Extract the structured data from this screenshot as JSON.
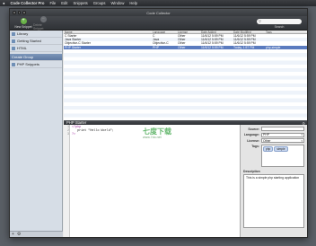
{
  "menubar": {
    "apple": "",
    "items": [
      "Code Collector Pro",
      "File",
      "Edit",
      "Snippets",
      "Groups",
      "Window",
      "Help"
    ]
  },
  "window": {
    "title": "Code Collector"
  },
  "toolbar": {
    "new_label": "New Snippet",
    "delete_label": "Delete Snippet",
    "search_placeholder": "",
    "search_label": "Search"
  },
  "sidebar": {
    "items": [
      {
        "label": "Library"
      },
      {
        "label": "Getting Started"
      },
      {
        "label": "HTML"
      },
      {
        "label": "Create Group"
      },
      {
        "label": "PHP Snippets"
      }
    ],
    "bottom": {
      "add": "+",
      "gear": "⚙"
    }
  },
  "table": {
    "headers": [
      "Name",
      "Language",
      "License",
      "Date Added",
      "Date Modified",
      "Tags"
    ],
    "rows": [
      {
        "name": "C Starter",
        "language": "C",
        "license": "Other",
        "added": "11/6/12 5:59 PM",
        "modified": "11/6/12 5:59 PM",
        "tags": ""
      },
      {
        "name": "Java Starter",
        "language": "Java",
        "license": "Other",
        "added": "11/6/12 5:59 PM",
        "modified": "11/6/12 5:59 PM",
        "tags": ""
      },
      {
        "name": "Objective-C Starter",
        "language": "Objective-C",
        "license": "Other",
        "added": "11/6/12 5:59 PM",
        "modified": "11/6/12 5:59 PM",
        "tags": ""
      },
      {
        "name": "PHP Starter",
        "language": "PHP",
        "license": "Other",
        "added": "11/6/12 5:59 PM",
        "modified": "Today, 1:57 PM",
        "tags": "php,simple"
      }
    ],
    "selected_index": 3
  },
  "detail": {
    "title": "PHP Starter",
    "code": [
      {
        "n": "1",
        "t": "<?php"
      },
      {
        "n": "2",
        "t": "   print \"Hello World\";"
      },
      {
        "n": "3",
        "t": "?>"
      }
    ]
  },
  "inspector": {
    "source_label": "Source:",
    "source_value": "",
    "language_label": "Language:",
    "language_value": "PHP",
    "license_label": "License:",
    "license_value": "Other",
    "tags_label": "Tags:",
    "tags": [
      "php",
      "simple"
    ],
    "description_label": "Description",
    "description_value": "This is a simple php starting application"
  },
  "watermark": {
    "text": "七度下载",
    "url": "www.7do.net"
  },
  "colors": {
    "selection": "#5a7bbf",
    "sidebar": "#d6dde6",
    "toolbar": "#3a3d42",
    "new_button": "#69b247"
  }
}
